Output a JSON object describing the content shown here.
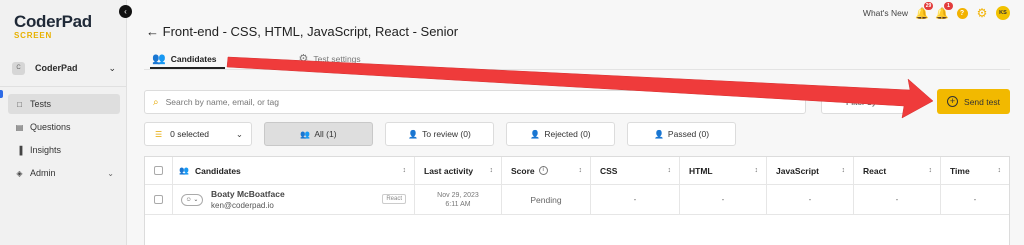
{
  "logo": {
    "main": "CoderPad",
    "sub": "SCREEN"
  },
  "sidebar": {
    "collapse_icon": "chevron-left-icon",
    "org": {
      "avatar": "C",
      "name": "CoderPad"
    },
    "items": [
      {
        "label": "Tests",
        "icon": "document-icon",
        "active": true
      },
      {
        "label": "Questions",
        "icon": "question-list-icon"
      },
      {
        "label": "Insights",
        "icon": "bar-chart-icon"
      },
      {
        "label": "Admin",
        "icon": "shield-icon"
      }
    ]
  },
  "topbar": {
    "whats_new": "What's New",
    "whats_new_badge": "29",
    "bell_badge": "1",
    "help": "?",
    "avatar": "KS"
  },
  "page": {
    "title": "Front-end - CSS, HTML, JavaScript, React - Senior",
    "tabs": [
      {
        "label": "Candidates",
        "active": true
      },
      {
        "label": "Test settings"
      }
    ]
  },
  "search": {
    "placeholder": "Search by name, email, or tag"
  },
  "filter_label": "Filter by",
  "send_test_label": "Send test",
  "selection": {
    "label": "0 selected"
  },
  "chips": [
    {
      "label": "All (1)",
      "active": true
    },
    {
      "label": "To review (0)"
    },
    {
      "label": "Rejected (0)"
    },
    {
      "label": "Passed (0)"
    }
  ],
  "table": {
    "headers": [
      "Candidates",
      "Last activity",
      "Score",
      "CSS",
      "HTML",
      "JavaScript",
      "React",
      "Time"
    ],
    "rows": [
      {
        "name": "Boaty McBoatface",
        "email": "ken@coderpad.io",
        "tag": "React",
        "date": "Nov 29, 2023",
        "time": "6:11 AM",
        "score": "Pending",
        "css": "-",
        "html": "-",
        "javascript": "-",
        "react": "-",
        "time_taken": "-"
      }
    ]
  },
  "colors": {
    "accent": "#f2b900",
    "arrow": "#ef3b3b",
    "brand_sub": "#e8b100"
  }
}
